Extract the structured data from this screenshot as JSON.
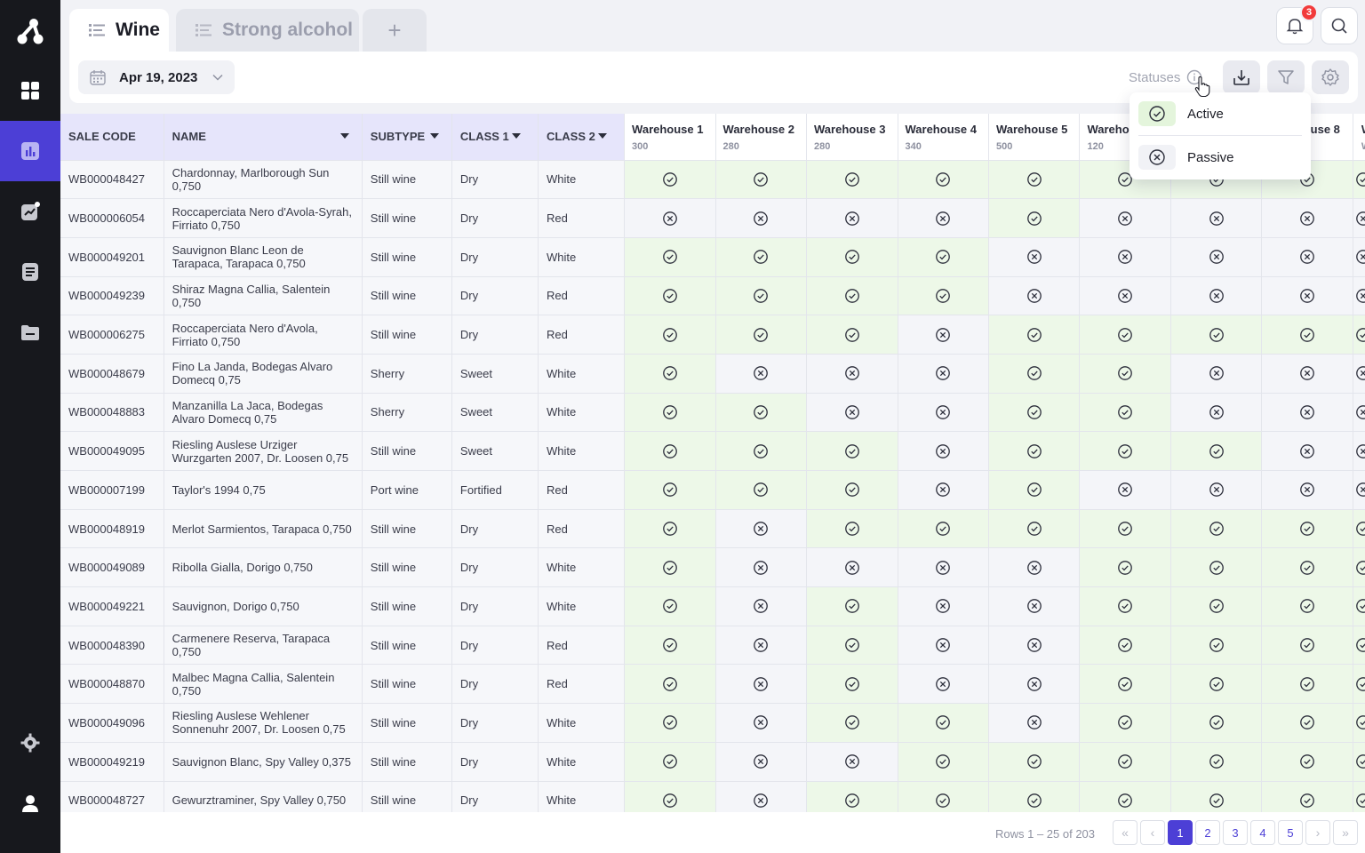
{
  "tabs": [
    {
      "label": "Wine",
      "active": true
    },
    {
      "label": "Strong alcohol",
      "active": false
    }
  ],
  "tab_add_label": "+",
  "notifications": {
    "count": "3"
  },
  "toolbar": {
    "date": "Apr 19, 2023",
    "statuses_label": "Statuses"
  },
  "status_menu": {
    "items": [
      {
        "label": "Active",
        "icon": "check-circle-icon"
      },
      {
        "label": "Passive",
        "icon": "x-circle-icon"
      }
    ]
  },
  "table": {
    "headers": {
      "sale_code": "SALE CODE",
      "name": "NAME",
      "subtype": "SUBTYPE",
      "class1": "CLASS 1",
      "class2": "CLASS 2"
    },
    "warehouses": [
      {
        "name": "Warehouse 1",
        "count": "300"
      },
      {
        "name": "Warehouse 2",
        "count": "280"
      },
      {
        "name": "Warehouse 3",
        "count": "280"
      },
      {
        "name": "Warehouse 4",
        "count": "340"
      },
      {
        "name": "Warehouse 5",
        "count": "500"
      },
      {
        "name": "Warehou",
        "count": "120"
      },
      {
        "name": "",
        "count": ""
      },
      {
        "name": "use 8",
        "count": ""
      },
      {
        "name": "W",
        "count": "W"
      }
    ],
    "rows": [
      {
        "code": "WB000048427",
        "name": "Chardonnay, Marlborough Sun 0,750",
        "subtype": "Still wine",
        "class1": "Dry",
        "class2": "White",
        "status": [
          1,
          1,
          1,
          1,
          1,
          1,
          1,
          1,
          1
        ]
      },
      {
        "code": "WB000006054",
        "name": "Roccaperciata Nero d'Avola-Syrah, Firriato 0,750",
        "subtype": "Still wine",
        "class1": "Dry",
        "class2": "Red",
        "status": [
          0,
          0,
          0,
          0,
          1,
          0,
          0,
          0,
          0
        ]
      },
      {
        "code": "WB000049201",
        "name": "Sauvignon Blanc Leon de Tarapaca, Tarapaca 0,750",
        "subtype": "Still wine",
        "class1": "Dry",
        "class2": "White",
        "status": [
          1,
          1,
          1,
          1,
          0,
          0,
          0,
          0,
          0
        ]
      },
      {
        "code": "WB000049239",
        "name": "Shiraz Magna Callia, Salentein 0,750",
        "subtype": "Still wine",
        "class1": "Dry",
        "class2": "Red",
        "status": [
          1,
          1,
          1,
          1,
          0,
          0,
          0,
          0,
          0
        ]
      },
      {
        "code": "WB000006275",
        "name": "Roccaperciata Nero d'Avola, Firriato 0,750",
        "subtype": "Still wine",
        "class1": "Dry",
        "class2": "Red",
        "status": [
          1,
          1,
          1,
          0,
          1,
          1,
          1,
          1,
          1
        ]
      },
      {
        "code": "WB000048679",
        "name": "Fino La Janda, Bodegas Alvaro Domecq 0,75",
        "subtype": "Sherry",
        "class1": "Sweet",
        "class2": "White",
        "status": [
          1,
          0,
          0,
          0,
          1,
          1,
          0,
          0,
          0
        ]
      },
      {
        "code": "WB000048883",
        "name": "Manzanilla La Jaca, Bodegas Alvaro Domecq 0,75",
        "subtype": "Sherry",
        "class1": "Sweet",
        "class2": "White",
        "status": [
          1,
          1,
          0,
          0,
          1,
          1,
          0,
          0,
          0
        ]
      },
      {
        "code": "WB000049095",
        "name": "Riesling Auslese Urziger Wurzgarten 2007, Dr. Loosen 0,75",
        "subtype": "Still wine",
        "class1": "Sweet",
        "class2": "White",
        "status": [
          1,
          1,
          1,
          0,
          1,
          1,
          1,
          0,
          0
        ]
      },
      {
        "code": "WB000007199",
        "name": "Taylor's 1994 0,75",
        "subtype": "Port wine",
        "class1": "Fortified",
        "class2": "Red",
        "status": [
          1,
          1,
          1,
          0,
          1,
          0,
          0,
          0,
          0
        ]
      },
      {
        "code": "WB000048919",
        "name": "Merlot Sarmientos, Tarapaca 0,750",
        "subtype": "Still wine",
        "class1": "Dry",
        "class2": "Red",
        "status": [
          1,
          0,
          1,
          1,
          1,
          1,
          1,
          1,
          1
        ]
      },
      {
        "code": "WB000049089",
        "name": "Ribolla Gialla, Dorigo 0,750",
        "subtype": "Still wine",
        "class1": "Dry",
        "class2": "White",
        "status": [
          1,
          0,
          0,
          0,
          0,
          1,
          1,
          1,
          1
        ]
      },
      {
        "code": "WB000049221",
        "name": "Sauvignon, Dorigo 0,750",
        "subtype": "Still wine",
        "class1": "Dry",
        "class2": "White",
        "status": [
          1,
          0,
          1,
          0,
          0,
          1,
          1,
          1,
          1
        ]
      },
      {
        "code": "WB000048390",
        "name": "Carmenere Reserva, Tarapaca 0,750",
        "subtype": "Still wine",
        "class1": "Dry",
        "class2": "Red",
        "status": [
          1,
          0,
          1,
          0,
          0,
          1,
          1,
          1,
          1
        ]
      },
      {
        "code": "WB000048870",
        "name": "Malbec Magna Callia, Salentein 0,750",
        "subtype": "Still wine",
        "class1": "Dry",
        "class2": "Red",
        "status": [
          1,
          0,
          1,
          0,
          0,
          1,
          1,
          1,
          1
        ]
      },
      {
        "code": "WB000049096",
        "name": "Riesling Auslese Wehlener Sonnenuhr 2007, Dr. Loosen 0,75",
        "subtype": "Still wine",
        "class1": "Dry",
        "class2": "White",
        "status": [
          1,
          0,
          1,
          1,
          0,
          1,
          1,
          1,
          1
        ]
      },
      {
        "code": "WB000049219",
        "name": "Sauvignon Blanc, Spy Valley 0,375",
        "subtype": "Still wine",
        "class1": "Dry",
        "class2": "White",
        "status": [
          1,
          0,
          0,
          1,
          1,
          1,
          1,
          1,
          1
        ]
      },
      {
        "code": "WB000048727",
        "name": "Gewurztraminer, Spy Valley 0,750",
        "subtype": "Still wine",
        "class1": "Dry",
        "class2": "White",
        "status": [
          1,
          0,
          1,
          1,
          1,
          1,
          1,
          1,
          1
        ]
      }
    ]
  },
  "pagination": {
    "rows_info": "Rows 1 – 25 of 203",
    "pages": [
      "1",
      "2",
      "3",
      "4",
      "5"
    ],
    "current_page": "1",
    "first_icon": "«",
    "prev_icon": "‹",
    "next_icon": "›",
    "last_icon": "»"
  },
  "colors": {
    "accent": "#4c3fd6",
    "sidebar_bg": "#17181d",
    "active_cell": "#edf8e8",
    "passive_cell": "#f4f5f9",
    "badge": "#f23b3b"
  },
  "sidebar_icons": [
    "logo-icon",
    "dashboard-icon",
    "analytics-icon",
    "trend-icon",
    "document-icon",
    "folder-icon",
    "settings-icon",
    "user-icon"
  ]
}
